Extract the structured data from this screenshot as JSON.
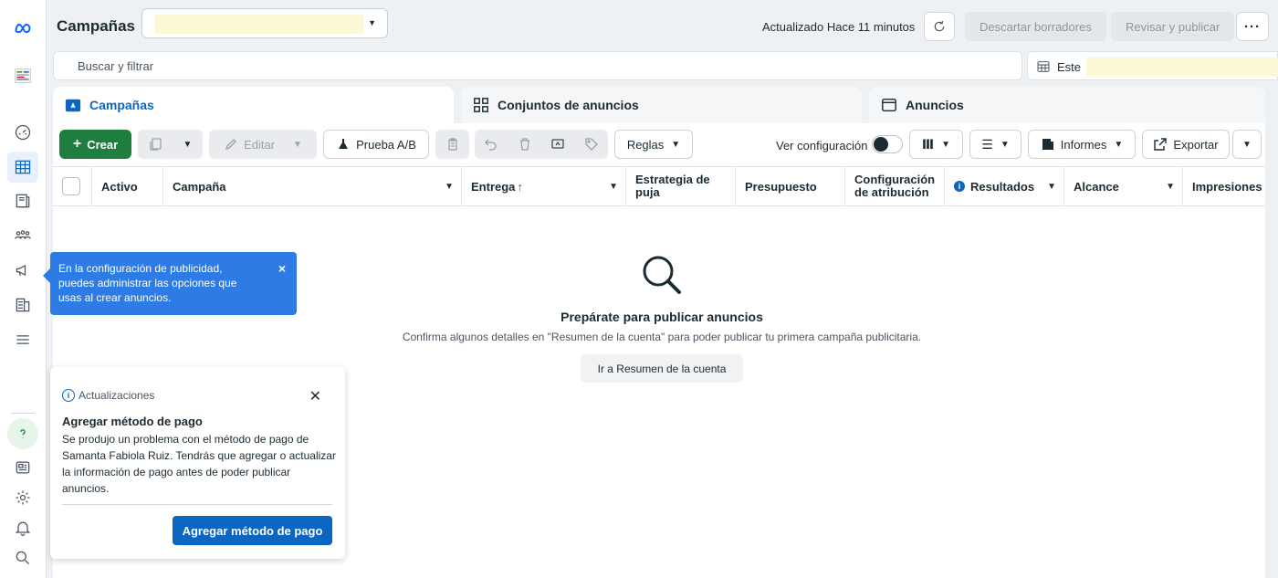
{
  "header": {
    "title": "Campañas",
    "updated": "Actualizado Hace 11 minutos",
    "discard_label": "Descartar borradores",
    "review_label": "Revisar y publicar",
    "more_label": "···"
  },
  "search": {
    "placeholder": "Buscar y filtrar",
    "date_label": "Este"
  },
  "tabs": [
    {
      "label": "Campañas",
      "active": true
    },
    {
      "label": "Conjuntos de anuncios",
      "active": false
    },
    {
      "label": "Anuncios",
      "active": false
    }
  ],
  "toolbar": {
    "create_label": "Crear",
    "edit_label": "Editar",
    "ab_test_label": "Prueba A/B",
    "rules_label": "Reglas",
    "view_config_label": "Ver configuración",
    "reports_label": "Informes",
    "export_label": "Exportar"
  },
  "table": {
    "columns": [
      "Activo",
      "Campaña",
      "Entrega",
      "Estrategia de puja",
      "Presupuesto",
      "Configuración de atribución",
      "Resultados",
      "Alcance",
      "Impresiones"
    ],
    "sort_arrow": "↑"
  },
  "empty_state": {
    "title": "Prepárate para publicar anuncios",
    "subtitle": "Confirma algunos detalles en \"Resumen de la cuenta\" para poder publicar tu primera campaña publicitaria.",
    "button_label": "Ir a Resumen de la cuenta"
  },
  "tooltip": {
    "text": "En la configuración de publicidad, puedes administrar las opciones que usas al crear anuncios.",
    "close": "×"
  },
  "updates_card": {
    "header": "Actualizaciones",
    "title": "Agregar método de pago",
    "body": "Se produjo un problema con el método de pago de Samanta Fabiola Ruiz. Tendrás que agregar o actualizar la información de pago antes de poder publicar anuncios.",
    "button_label": "Agregar método de pago",
    "close": "✕"
  },
  "colors": {
    "accent": "#0a66c2",
    "create_green": "#1e7e3e",
    "tooltip_blue": "#2d7be5"
  }
}
